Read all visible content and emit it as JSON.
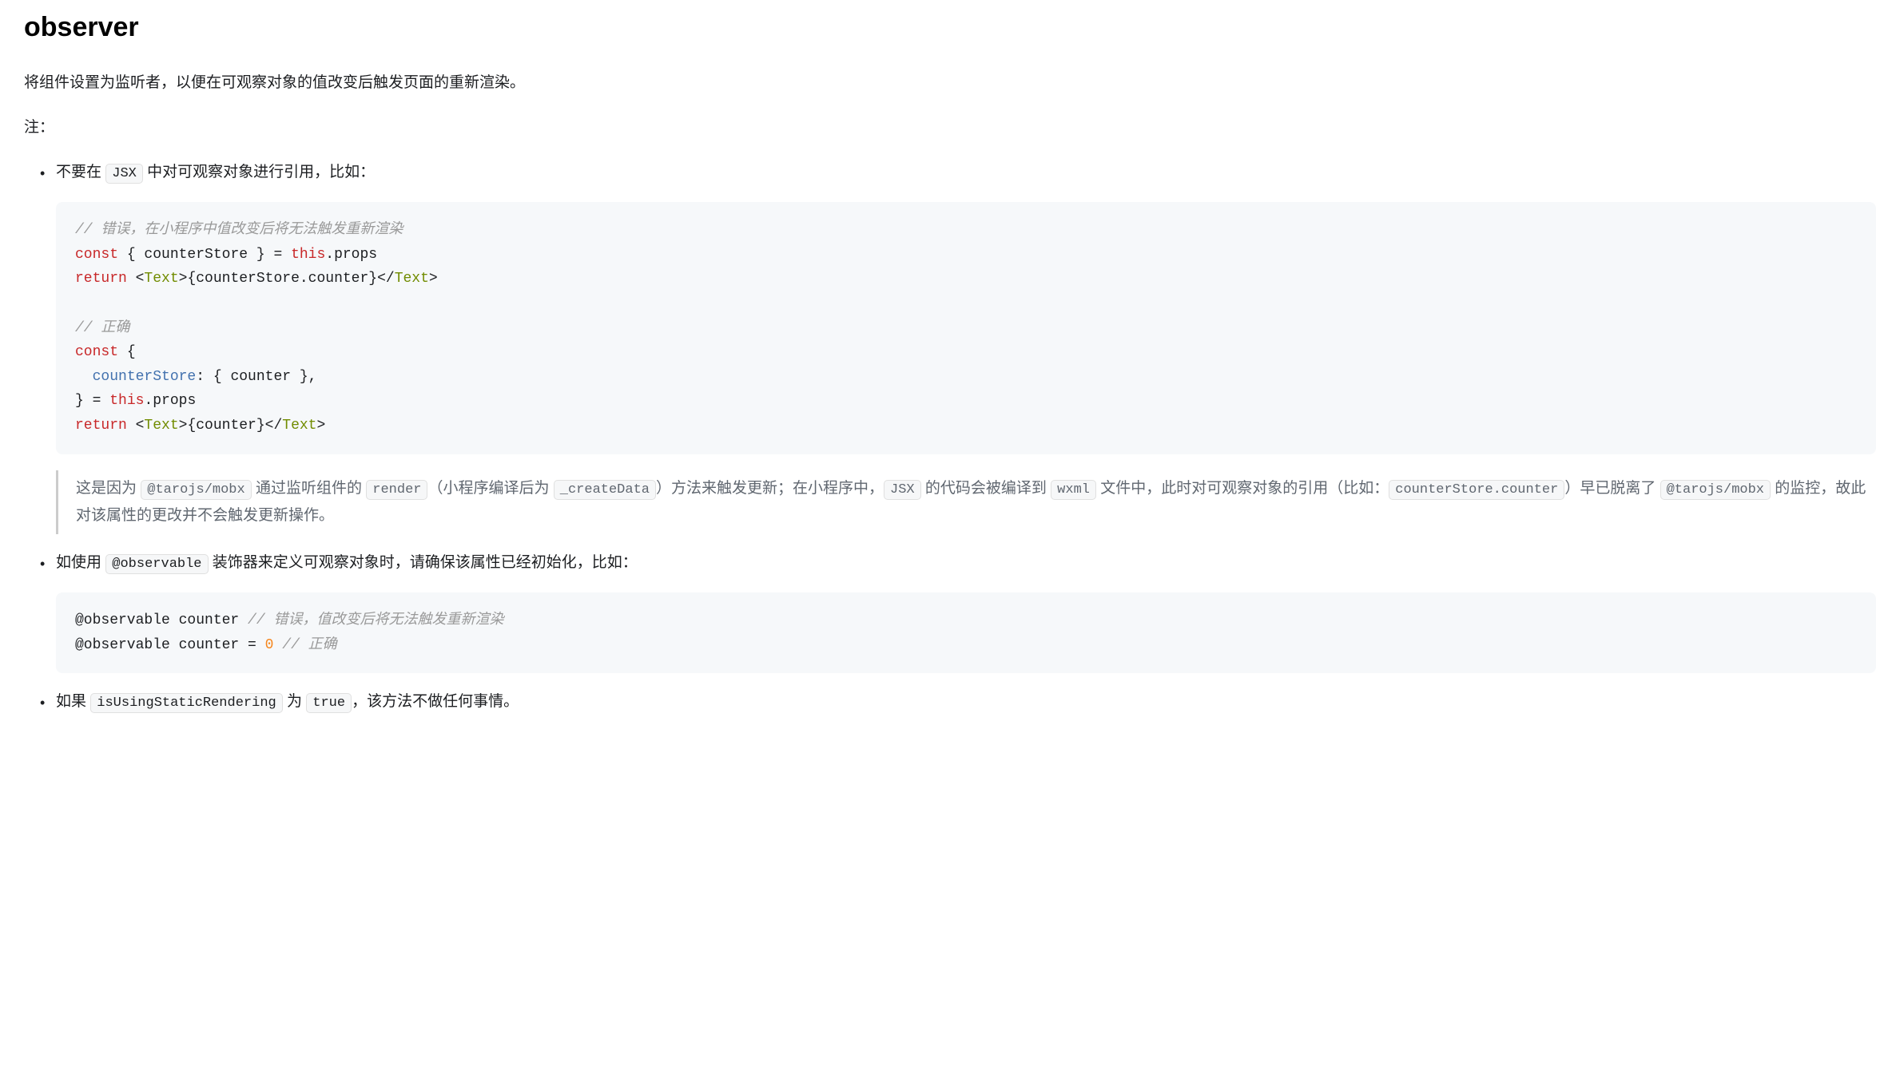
{
  "heading": "observer",
  "intro": "将组件设置为监听者，以便在可观察对象的值改变后触发页面的重新渲染。",
  "note_label": "注：",
  "bullet1": {
    "pre": "不要在 ",
    "code": "JSX",
    "post": " 中对可观察对象进行引用，比如："
  },
  "code1": {
    "c1": "// 错误，在小程序中值改变后将无法触发重新渲染",
    "l1a": "const",
    "l1b": " { counterStore } = ",
    "l1c": "this",
    "l1d": ".props",
    "l2a": "return",
    "l2b": " <",
    "l2tag1": "Text",
    "l2c": ">{counterStore.counter}</",
    "l2tag2": "Text",
    "l2d": ">",
    "c2": "// 正确",
    "l3": "const",
    "l3b": " {",
    "l4a": "  ",
    "l4attr": "counterStore",
    "l4b": ": { counter },",
    "l5": "} = ",
    "l5this": "this",
    "l5b": ".props",
    "l6a": "return",
    "l6b": " <",
    "l6tag1": "Text",
    "l6c": ">{counter}</",
    "l6tag2": "Text",
    "l6d": ">"
  },
  "blockquote": {
    "t1": "这是因为 ",
    "c1": "@tarojs/mobx",
    "t2": " 通过监听组件的 ",
    "c2": "render",
    "t3": "（小程序编译后为 ",
    "c3": "_createData",
    "t4": "）方法来触发更新；在小程序中，",
    "c4": "JSX",
    "t5": " 的代码会被编译到 ",
    "c5": "wxml",
    "t6": " 文件中，此时对可观察对象的引用（比如：",
    "c6": "counterStore.counter",
    "t7": "）早已脱离了 ",
    "c7": "@tarojs/mobx",
    "t8": " 的监控，故此对该属性的更改并不会触发更新操作。"
  },
  "bullet2": {
    "pre": "如使用 ",
    "code": "@observable",
    "post": " 装饰器来定义可观察对象时，请确保该属性已经初始化，比如："
  },
  "code2": {
    "l1a": "@observable counter ",
    "c1": "// 错误，值改变后将无法触发重新渲染",
    "l2a": "@observable counter = ",
    "num": "0",
    "l2b": " ",
    "c2": "// 正确"
  },
  "bullet3": {
    "t1": "如果 ",
    "c1": "isUsingStaticRendering",
    "t2": " 为 ",
    "c2": "true",
    "t3": "，该方法不做任何事情。"
  }
}
